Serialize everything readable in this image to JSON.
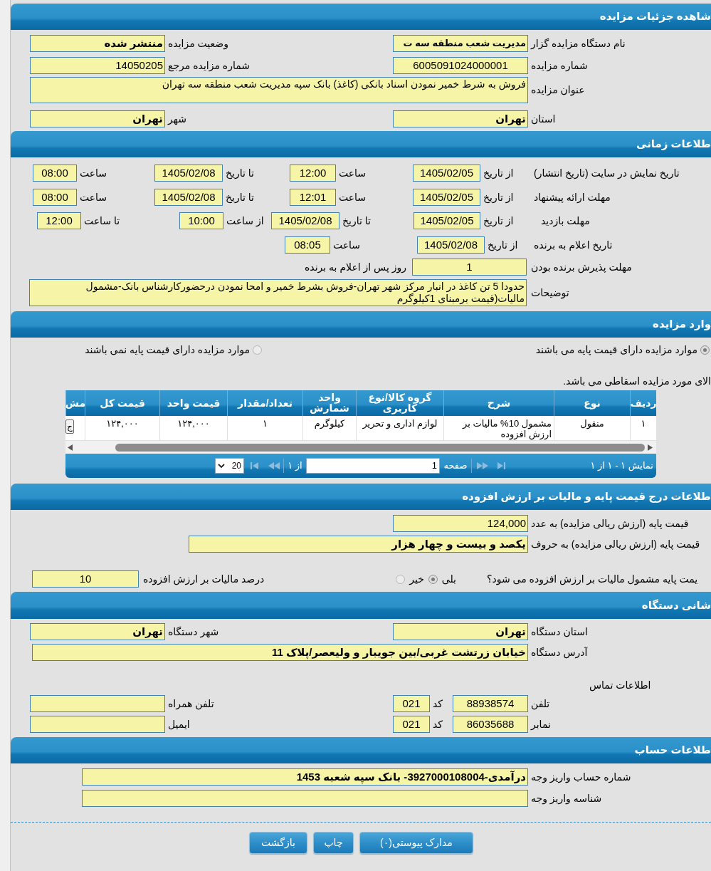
{
  "auction_details": {
    "title": "شاهده جزئیات مزایده",
    "organizer": {
      "label": "نام دستگاه مزایده گزار",
      "value": "مدیریت شعب منطقه سه ت"
    },
    "status": {
      "label": "وضعیت مزایده",
      "value": "منتشر شده"
    },
    "auction_number": {
      "label": "شماره مزایده",
      "value": "6005091024000001"
    },
    "reference_number": {
      "label": "شماره مزایده مرجع",
      "value": "14050205"
    },
    "subject": {
      "label": "عنوان مزایده",
      "value": "فروش به شرط خمیر نمودن اسناد بانکی (کاغذ) بانک سپه مدیریت شعب منطقه سه تهران"
    },
    "province": {
      "label": "استان",
      "value": "تهران"
    },
    "city": {
      "label": "شهر",
      "value": "تهران"
    }
  },
  "timing": {
    "title": "طلاعات زمانی",
    "display": {
      "label": "تاریخ نمایش در سایت (تاریخ انتشار)",
      "from_date_label": "از تاریخ",
      "from_date": "1405/02/05",
      "from_time_label": "ساعت",
      "from_time": "12:00",
      "to_date_label": "تا تاریخ",
      "to_date": "1405/02/08",
      "to_time_label": "ساعت",
      "to_time": "08:00"
    },
    "offer_deadline": {
      "label": "مهلت ارائه پیشنهاد",
      "from_date_label": "از تاریخ",
      "from_date": "1405/02/05",
      "from_time_label": "ساعت",
      "from_time": "12:01",
      "to_date_label": "تا تاریخ",
      "to_date": "1405/02/08",
      "to_time_label": "ساعت",
      "to_time": "08:00"
    },
    "visit": {
      "label": "مهلت بازدید",
      "from_date_label": "از تاریخ",
      "from_date": "1405/02/05",
      "to_date_label": "تا تاریخ",
      "to_date": "1405/02/08",
      "from_time_label": "از ساعت",
      "from_time": "10:00",
      "to_time_label": "تا ساعت",
      "to_time": "12:00"
    },
    "winner_announcement": {
      "label": "تاریخ اعلام به برنده",
      "date_label": "از تاریخ",
      "date": "1405/02/08",
      "time_label": "ساعت",
      "time": "08:05"
    },
    "acceptance": {
      "label": "مهلت پذیرش برنده بودن",
      "value": "1",
      "suffix": "روز پس از اعلام به برنده"
    },
    "notes": {
      "label": "توضیحات",
      "value": "حدودا 5 تن کاغذ در انبار مرکز شهر تهران-فروش بشرط خمیر و امحا نمودن درحضورکارشناس بانک-مشمول مالیات(قیمت برمبنای 1کیلوگرم"
    }
  },
  "items": {
    "title": "وارد مزایده",
    "options": [
      {
        "label": "موارد مزایده دارای قیمت پایه می باشند",
        "selected": true
      },
      {
        "label": "موارد مزایده دارای قیمت پایه نمی باشند",
        "selected": false
      }
    ],
    "note": "الای مورد مزایده اسقاطی می باشد.",
    "table": {
      "columns": [
        "ردیف",
        "نوع",
        "شرح",
        "گروه کالا/نوع کاربری",
        "واحد شمارش",
        "تعداد/مقدار",
        "قیمت واحد",
        "قیمت کل",
        "مش"
      ],
      "rows": [
        {
          "cells": [
            "۱",
            "منقول",
            "مشمول 10% مالیات بر ارزش افزوده",
            "لوازم اداری و تحریر",
            "کیلوگرم",
            "۱",
            "۱۲۴,۰۰۰",
            "۱۲۴,۰۰۰"
          ],
          "action": "ج"
        }
      ]
    },
    "pager": {
      "summary": "نمایش ۱ - ۱ از ۱",
      "page_label": "صفحه",
      "page": "1",
      "page_count": "از ۱",
      "page_size": "20"
    }
  },
  "pricing": {
    "title": "طلاعات درج قیمت پایه و مالیات بر ارزش افزوده",
    "base_price_number": {
      "label": "قیمت پایه (ارزش ریالی مزایده) به عدد",
      "value": "124,000"
    },
    "base_price_words": {
      "label": "قیمت پایه (ارزش ریالی مزایده) به حروف",
      "value": "یکصد و بیست و چهار هزار"
    },
    "vat_included": {
      "label": "یمت پایه مشمول مالیات بر ارزش افزوده می شود؟",
      "options": [
        {
          "label": "بلی",
          "selected": true
        },
        {
          "label": "خیر",
          "selected": false
        }
      ]
    },
    "vat_percent": {
      "label": "درصد مالیات بر ارزش افزوده",
      "value": "10"
    }
  },
  "address": {
    "title": "شانی دستگاه",
    "province": {
      "label": "استان دستگاه",
      "value": "تهران"
    },
    "city": {
      "label": "شهر دستگاه",
      "value": "تهران"
    },
    "street": {
      "label": "آدرس دستگاه",
      "value": "خیابان زرتشت غربی/بین جویبار و ولیعصر/پلاک 11"
    },
    "contact_title": "اطلاعات تماس",
    "phone": {
      "label": "تلفن",
      "value": "88938574",
      "code_label": "کد",
      "code": "021"
    },
    "mobile": {
      "label": "تلفن همراه"
    },
    "fax": {
      "label": "نمابر",
      "value": "86035688",
      "code_label": "کد",
      "code": "021"
    },
    "email": {
      "label": "ایمیل"
    }
  },
  "account": {
    "title": "طلاعات حساب",
    "number": {
      "label": "شماره حساب واریز وجه",
      "value": "درآمدی-3927000108004- بانک سپه شعبه 1453"
    },
    "payment_id": {
      "label": "شناسه واریز وجه"
    }
  },
  "buttons": [
    {
      "kind": "attachments",
      "label": "مدارک پیوستی(۰)"
    },
    {
      "kind": "print",
      "label": "چاپ"
    },
    {
      "kind": "back",
      "label": "بازگشت"
    }
  ]
}
